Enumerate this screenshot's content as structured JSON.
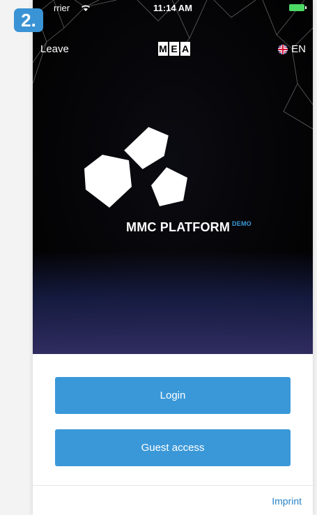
{
  "step_badge": "2.",
  "status_bar": {
    "carrier": "rrier",
    "time": "11:14 AM"
  },
  "nav": {
    "leave_label": "Leave",
    "logo_letters": [
      "M",
      "E",
      "A"
    ],
    "language": "EN"
  },
  "brand": {
    "name": "MMC PLATFORM",
    "tag": "DEMO"
  },
  "actions": {
    "login_label": "Login",
    "guest_label": "Guest access"
  },
  "footer": {
    "imprint_label": "Imprint"
  },
  "colors": {
    "primary": "#3a98d8",
    "link": "#2a82c4",
    "badge": "#3a93d4"
  }
}
